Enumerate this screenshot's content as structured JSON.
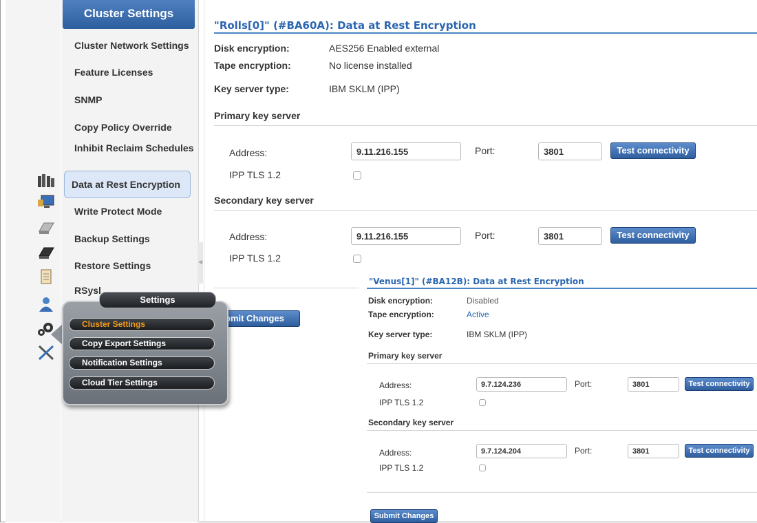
{
  "nav": {
    "header": "Cluster Settings",
    "items": [
      {
        "label": "Cluster Network Settings"
      },
      {
        "label": "Feature Licenses"
      },
      {
        "label": "SNMP"
      },
      {
        "label": "Copy Policy Override"
      },
      {
        "label": "Inhibit Reclaim Schedules"
      },
      {
        "label": "Data at Rest Encryption"
      },
      {
        "label": "Write Protect Mode"
      },
      {
        "label": "Backup Settings"
      },
      {
        "label": "Restore Settings"
      },
      {
        "label": "RSysl"
      }
    ]
  },
  "rail_icons": [
    "cluster-icon",
    "monitor-icon",
    "tape-drive-icon",
    "virtual-drive-icon",
    "clipboard-icon",
    "user-icon",
    "settings-gears-icon",
    "service-tools-icon"
  ],
  "main": {
    "title": "\"Rolls[0]\" (#BA60A): Data at Rest Encryption",
    "disk_label": "Disk encryption:",
    "disk_value": "AES256 Enabled external",
    "tape_label": "Tape encryption:",
    "tape_value": "No license installed",
    "kst_label": "Key server type:",
    "kst_value": "IBM SKLM (IPP)",
    "primary": {
      "heading": "Primary key server",
      "address_label": "Address:",
      "address": "9.11.216.155",
      "port_label": "Port:",
      "port": "3801",
      "test_button": "Test connectivity",
      "tls_label": "IPP TLS 1.2"
    },
    "secondary": {
      "heading": "Secondary key server",
      "address_label": "Address:",
      "address": "9.11.216.155",
      "port_label": "Port:",
      "port": "3801",
      "test_button": "Test connectivity",
      "tls_label": "IPP TLS 1.2"
    },
    "submit_button": "bmit Changes"
  },
  "venus": {
    "title": "\"Venus[1]\" (#BA12B): Data at Rest Encryption",
    "disk_label": "Disk encryption:",
    "disk_value": "Disabled",
    "tape_label": "Tape encryption:",
    "tape_value": "Active",
    "kst_label": "Key server type:",
    "kst_value": "IBM SKLM (IPP)",
    "primary": {
      "heading": "Primary key server",
      "address_label": "Address:",
      "address": "9.7.124.236",
      "port_label": "Port:",
      "port": "3801",
      "test_button": "Test connectivity",
      "tls_label": "IPP TLS 1.2"
    },
    "secondary": {
      "heading": "Secondary key server",
      "address_label": "Address:",
      "address": "9.7.124.204",
      "port_label": "Port:",
      "port": "3801",
      "test_button": "Test connectivity",
      "tls_label": "IPP TLS 1.2"
    },
    "submit_button": "Submit Changes"
  },
  "popup": {
    "title": "Settings",
    "items": [
      {
        "label": "Cluster Settings",
        "active": true
      },
      {
        "label": "Copy Export Settings"
      },
      {
        "label": "Notification Settings"
      },
      {
        "label": "Cloud Tier Settings"
      }
    ]
  },
  "colors": {
    "accent": "#2b66b1",
    "button": "#3a6aac",
    "popup_active": "#f39a1a"
  }
}
